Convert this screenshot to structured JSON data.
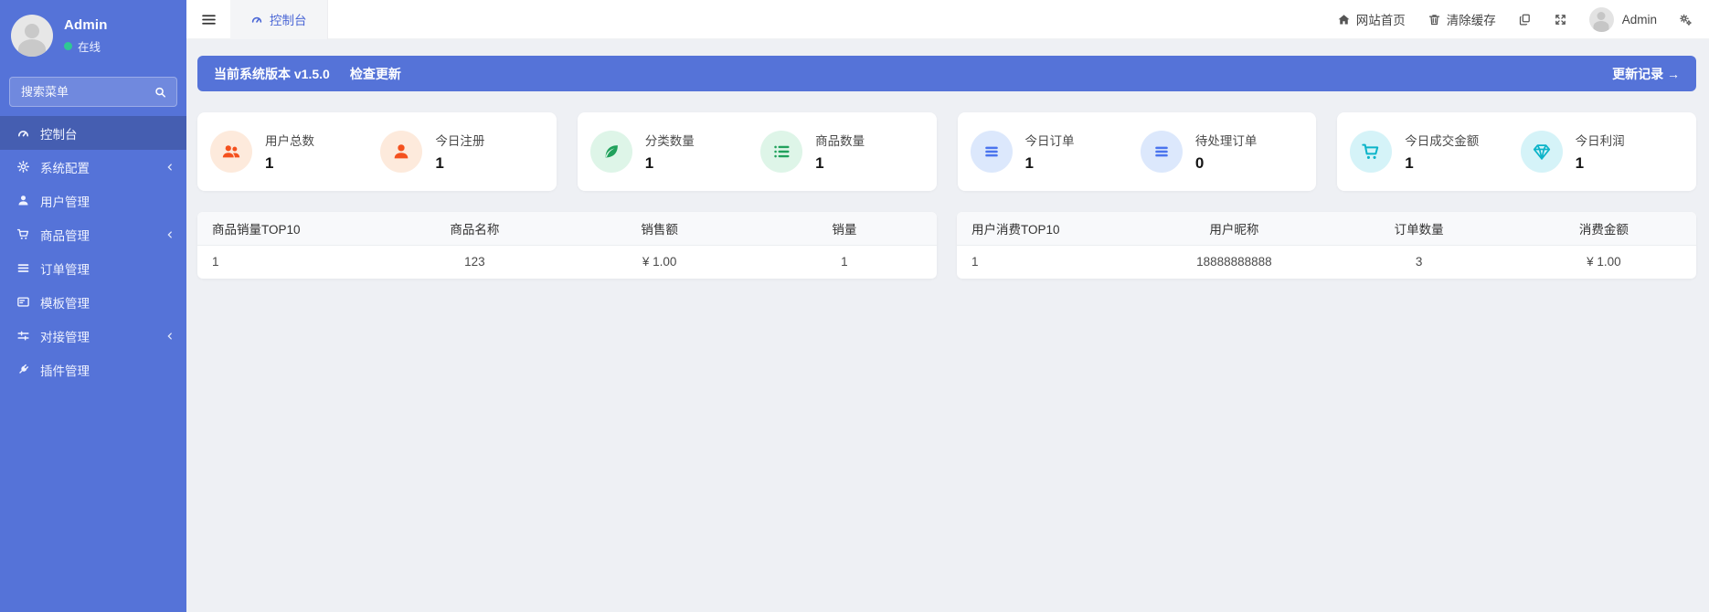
{
  "colors": {
    "sidebar_bg": "#5573d8",
    "banner_bg": "#5573d8",
    "online_dot": "#2fc893",
    "stat_orange": "#f4511e",
    "stat_green": "#21a15c",
    "stat_blue": "#4a74ee",
    "stat_teal": "#0cb4c9"
  },
  "sidebar": {
    "profile": {
      "name": "Admin",
      "status": "在线"
    },
    "search_placeholder": "搜索菜单",
    "menu": [
      {
        "label": "控制台",
        "icon": "dashboard-icon",
        "active": true
      },
      {
        "label": "系统配置",
        "icon": "gear-icon",
        "collapsible": true
      },
      {
        "label": "用户管理",
        "icon": "user-icon"
      },
      {
        "label": "商品管理",
        "icon": "cart-icon",
        "collapsible": true
      },
      {
        "label": "订单管理",
        "icon": "list-icon"
      },
      {
        "label": "模板管理",
        "icon": "template-icon"
      },
      {
        "label": "对接管理",
        "icon": "sliders-icon",
        "collapsible": true
      },
      {
        "label": "插件管理",
        "icon": "plugin-icon"
      }
    ]
  },
  "topbar": {
    "tab": "控制台",
    "home": "网站首页",
    "clear_cache": "清除缓存",
    "username": "Admin"
  },
  "banner": {
    "version_text": "当前系统版本 v1.5.0",
    "check_update": "检查更新",
    "changelog": "更新记录 →"
  },
  "stats": [
    {
      "label": "用户总数",
      "value": "1",
      "icon": "users-icon",
      "color": "#f4511e"
    },
    {
      "label": "今日注册",
      "value": "1",
      "icon": "user-icon",
      "color": "#f4511e"
    },
    {
      "label": "分类数量",
      "value": "1",
      "icon": "leaf-icon",
      "color": "#21a15c"
    },
    {
      "label": "商品数量",
      "value": "1",
      "icon": "list-check-icon",
      "color": "#21a15c"
    },
    {
      "label": "今日订单",
      "value": "1",
      "icon": "menu-lines-icon",
      "color": "#4a74ee"
    },
    {
      "label": "待处理订单",
      "value": "0",
      "icon": "menu-lines-icon",
      "color": "#4a74ee"
    },
    {
      "label": "今日成交金额",
      "value": "1",
      "icon": "cart-icon",
      "color": "#0cb4c9"
    },
    {
      "label": "今日利润",
      "value": "1",
      "icon": "gem-icon",
      "color": "#0cb4c9"
    }
  ],
  "tables": {
    "product": {
      "headers": [
        "商品销量TOP10",
        "商品名称",
        "销售额",
        "销量"
      ],
      "rows": [
        [
          "1",
          "123",
          "¥ 1.00",
          "1"
        ]
      ]
    },
    "user": {
      "headers": [
        "用户消费TOP10",
        "用户昵称",
        "订单数量",
        "消费金额"
      ],
      "rows": [
        [
          "1",
          "18888888888",
          "3",
          "¥ 1.00"
        ]
      ]
    }
  }
}
